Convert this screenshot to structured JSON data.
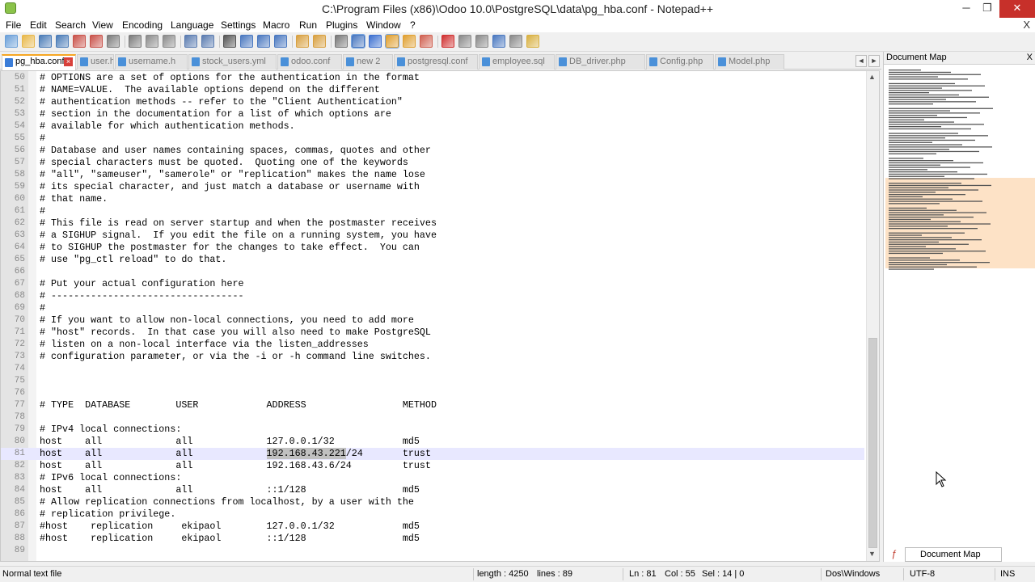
{
  "window": {
    "title": "C:\\Program Files (x86)\\Odoo 10.0\\PostgreSQL\\data\\pg_hba.conf - Notepad++",
    "controls": {
      "minimize": "─",
      "maximize": "❐",
      "close": "✕"
    }
  },
  "menu": {
    "items": [
      "File",
      "Edit",
      "Search",
      "View",
      "Encoding",
      "Language",
      "Settings",
      "Macro",
      "Run",
      "Plugins",
      "Window",
      "?"
    ],
    "close_label": "X"
  },
  "toolbar": {
    "buttons": [
      "new-file-icon",
      "open-file-icon",
      "save-icon",
      "save-all-icon",
      "close-icon",
      "close-all-icon",
      "print-icon",
      "cut-icon",
      "copy-icon",
      "paste-icon",
      "undo-icon",
      "redo-icon",
      "find-icon",
      "replace-icon",
      "zoom-in-icon",
      "zoom-out-icon",
      "sync-vertical-icon",
      "sync-horizontal-icon",
      "word-wrap-icon",
      "show-all-chars-icon",
      "indent-guide-icon",
      "document-map-icon",
      "function-list-icon",
      "folder-workspace-icon",
      "record-macro-icon",
      "stop-macro-icon",
      "play-macro-icon",
      "run-macro-multiple-icon",
      "save-macro-icon",
      "launch-explorer-icon"
    ]
  },
  "tabs": [
    {
      "label": "pg_hba.conf",
      "active": true
    },
    {
      "label": "user.h",
      "active": false
    },
    {
      "label": "username.h",
      "active": false
    },
    {
      "label": "stock_users.yml",
      "active": false
    },
    {
      "label": "odoo.conf",
      "active": false
    },
    {
      "label": "new 2",
      "active": false
    },
    {
      "label": "postgresql.conf",
      "active": false
    },
    {
      "label": "employee.sql",
      "active": false
    },
    {
      "label": "DB_driver.php",
      "active": false
    },
    {
      "label": "Config.php",
      "active": false
    },
    {
      "label": "Model.php",
      "active": false
    }
  ],
  "tab_nav": {
    "prev": "◄",
    "next": "►"
  },
  "editor": {
    "current_line": 81,
    "selection_text": "192.168.43.221",
    "lines": [
      {
        "n": "50",
        "text": "# OPTIONS are a set of options for the authentication in the format"
      },
      {
        "n": "51",
        "text": "# NAME=VALUE.  The available options depend on the different"
      },
      {
        "n": "52",
        "text": "# authentication methods -- refer to the \"Client Authentication\""
      },
      {
        "n": "53",
        "text": "# section in the documentation for a list of which options are"
      },
      {
        "n": "54",
        "text": "# available for which authentication methods."
      },
      {
        "n": "55",
        "text": "#"
      },
      {
        "n": "56",
        "text": "# Database and user names containing spaces, commas, quotes and other"
      },
      {
        "n": "57",
        "text": "# special characters must be quoted.  Quoting one of the keywords"
      },
      {
        "n": "58",
        "text": "# \"all\", \"sameuser\", \"samerole\" or \"replication\" makes the name lose"
      },
      {
        "n": "59",
        "text": "# its special character, and just match a database or username with"
      },
      {
        "n": "60",
        "text": "# that name."
      },
      {
        "n": "61",
        "text": "#"
      },
      {
        "n": "62",
        "text": "# This file is read on server startup and when the postmaster receives"
      },
      {
        "n": "63",
        "text": "# a SIGHUP signal.  If you edit the file on a running system, you have"
      },
      {
        "n": "64",
        "text": "# to SIGHUP the postmaster for the changes to take effect.  You can"
      },
      {
        "n": "65",
        "text": "# use \"pg_ctl reload\" to do that."
      },
      {
        "n": "66",
        "text": ""
      },
      {
        "n": "67",
        "text": "# Put your actual configuration here"
      },
      {
        "n": "68",
        "text": "# ----------------------------------"
      },
      {
        "n": "69",
        "text": "#"
      },
      {
        "n": "70",
        "text": "# If you want to allow non-local connections, you need to add more"
      },
      {
        "n": "71",
        "text": "# \"host\" records.  In that case you will also need to make PostgreSQL"
      },
      {
        "n": "72",
        "text": "# listen on a non-local interface via the listen_addresses"
      },
      {
        "n": "73",
        "text": "# configuration parameter, or via the -i or -h command line switches."
      },
      {
        "n": "74",
        "text": ""
      },
      {
        "n": "75",
        "text": ""
      },
      {
        "n": "76",
        "text": ""
      },
      {
        "n": "77",
        "text": "# TYPE  DATABASE        USER            ADDRESS                 METHOD"
      },
      {
        "n": "78",
        "text": ""
      },
      {
        "n": "79",
        "text": "# IPv4 local connections:"
      },
      {
        "n": "80",
        "text": "host    all             all             127.0.0.1/32            md5"
      },
      {
        "n": "81",
        "text": "host    all             all             192.168.43.221/24       trust"
      },
      {
        "n": "82",
        "text": "host    all             all             192.168.43.6/24         trust"
      },
      {
        "n": "83",
        "text": "# IPv6 local connections:"
      },
      {
        "n": "84",
        "text": "host    all             all             ::1/128                 md5"
      },
      {
        "n": "85",
        "text": "# Allow replication connections from localhost, by a user with the"
      },
      {
        "n": "86",
        "text": "# replication privilege."
      },
      {
        "n": "87",
        "text": "#host    replication     ekipaol        127.0.0.1/32            md5"
      },
      {
        "n": "88",
        "text": "#host    replication     ekipaol        ::1/128                 md5"
      },
      {
        "n": "89",
        "text": ""
      }
    ]
  },
  "document_map": {
    "title": "Document Map",
    "close_label": "X",
    "bottom_tab_label": "Document Map"
  },
  "status": {
    "file_type": "Normal text file",
    "length": "length : 4250",
    "lines": "lines : 89",
    "ln": "Ln : 81",
    "col": "Col : 55",
    "sel": "Sel : 14 | 0",
    "eol": "Dos\\Windows",
    "encoding": "UTF-8",
    "mode": "INS"
  },
  "colors": {
    "current_line": "#e8e8ff",
    "selection": "#c0c0c0",
    "active_tab_accent": "#f6a623",
    "close_red": "#c7302a",
    "map_highlight": "#fde2c6"
  }
}
